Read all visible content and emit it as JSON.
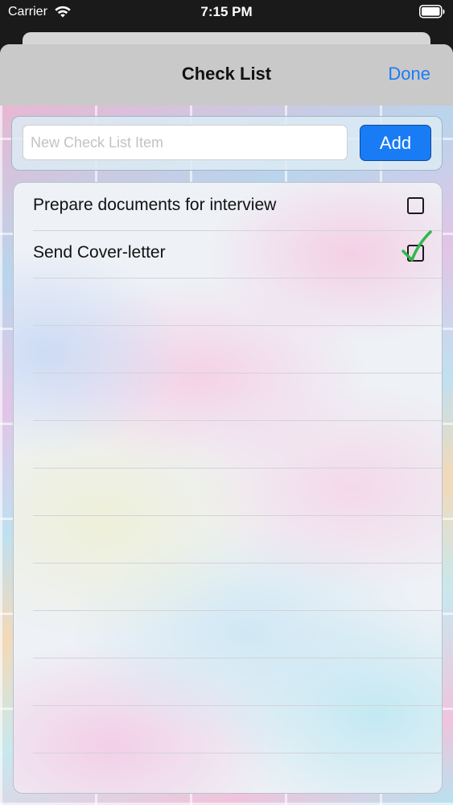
{
  "status_bar": {
    "carrier": "Carrier",
    "time": "7:15 PM"
  },
  "nav": {
    "title": "Check List",
    "done_label": "Done"
  },
  "entry": {
    "placeholder": "New Check List Item",
    "value": "",
    "add_label": "Add"
  },
  "checklist": {
    "items": [
      {
        "label": "Prepare documents for interview",
        "checked": false
      },
      {
        "label": "Send Cover-letter",
        "checked": true
      }
    ]
  },
  "colors": {
    "accent": "#1a7cf5",
    "check_green": "#2db84a"
  }
}
